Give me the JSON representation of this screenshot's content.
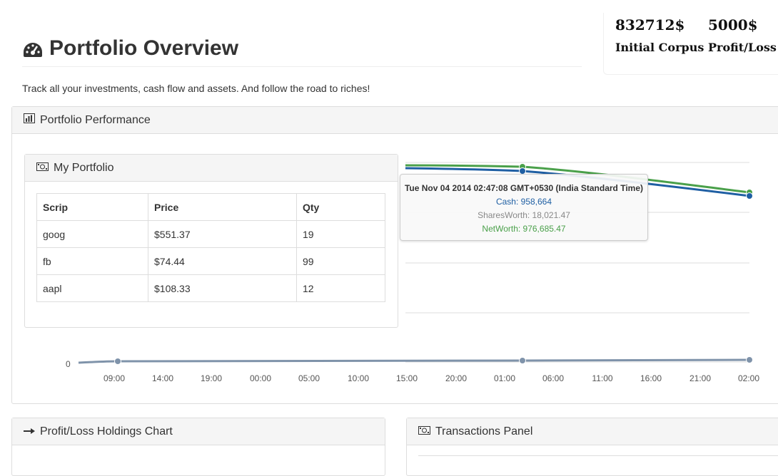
{
  "header": {
    "title": "Portfolio Overview",
    "subtitle": "Track all your investments, cash flow and assets. And follow the road to riches!",
    "title_icon": "dashboard-icon"
  },
  "stats": {
    "corpus_value": "832712$",
    "corpus_label": "Initial Corpus",
    "pl_value": "5000$",
    "pl_label": "Profit/Loss"
  },
  "panels": {
    "performance": {
      "label": "Portfolio Performance",
      "icon": "bar-chart-icon"
    },
    "my_portfolio": {
      "label": "My Portfolio",
      "icon": "money-icon"
    },
    "profit_loss": {
      "label": "Profit/Loss Holdings Chart",
      "icon": "arrow-right-icon"
    },
    "transactions": {
      "label": "Transactions Panel",
      "icon": "money-icon"
    }
  },
  "holdings": {
    "headers": [
      "Scrip",
      "Price",
      "Qty"
    ],
    "rows": [
      [
        "goog",
        "$551.37",
        "19"
      ],
      [
        "fb",
        "$74.44",
        "99"
      ],
      [
        "aapl",
        "$108.33",
        "12"
      ]
    ]
  },
  "chart_tooltip": {
    "title": "Tue Nov 04 2014 02:47:08 GMT+0530 (India Standard Time)",
    "cash": "Cash: 958,664",
    "shares": "SharesWorth: 18,021.47",
    "net": "NetWorth: 976,685.47"
  },
  "chart_data": {
    "type": "line",
    "x_ticks": [
      "09:00",
      "14:00",
      "19:00",
      "00:00",
      "05:00",
      "10:00",
      "15:00",
      "20:00",
      "01:00",
      "06:00",
      "11:00",
      "16:00",
      "21:00",
      "02:00"
    ],
    "y_tick_labels": [
      "0"
    ],
    "series": [
      {
        "name": "NetWorth",
        "color": "#4aa04a",
        "values": [
          null,
          null,
          null,
          null,
          null,
          null,
          null,
          null,
          976685,
          null,
          null,
          null,
          null,
          955000
        ]
      },
      {
        "name": "Cash",
        "color": "#1f5fa3",
        "values": [
          null,
          null,
          null,
          null,
          null,
          null,
          null,
          null,
          958664,
          null,
          null,
          null,
          null,
          940000
        ]
      },
      {
        "name": "SharesWorth",
        "color": "#7f93aa",
        "values": [
          0,
          18000,
          null,
          null,
          null,
          null,
          null,
          null,
          18021,
          null,
          null,
          null,
          null,
          18500
        ]
      }
    ],
    "grid": true
  }
}
